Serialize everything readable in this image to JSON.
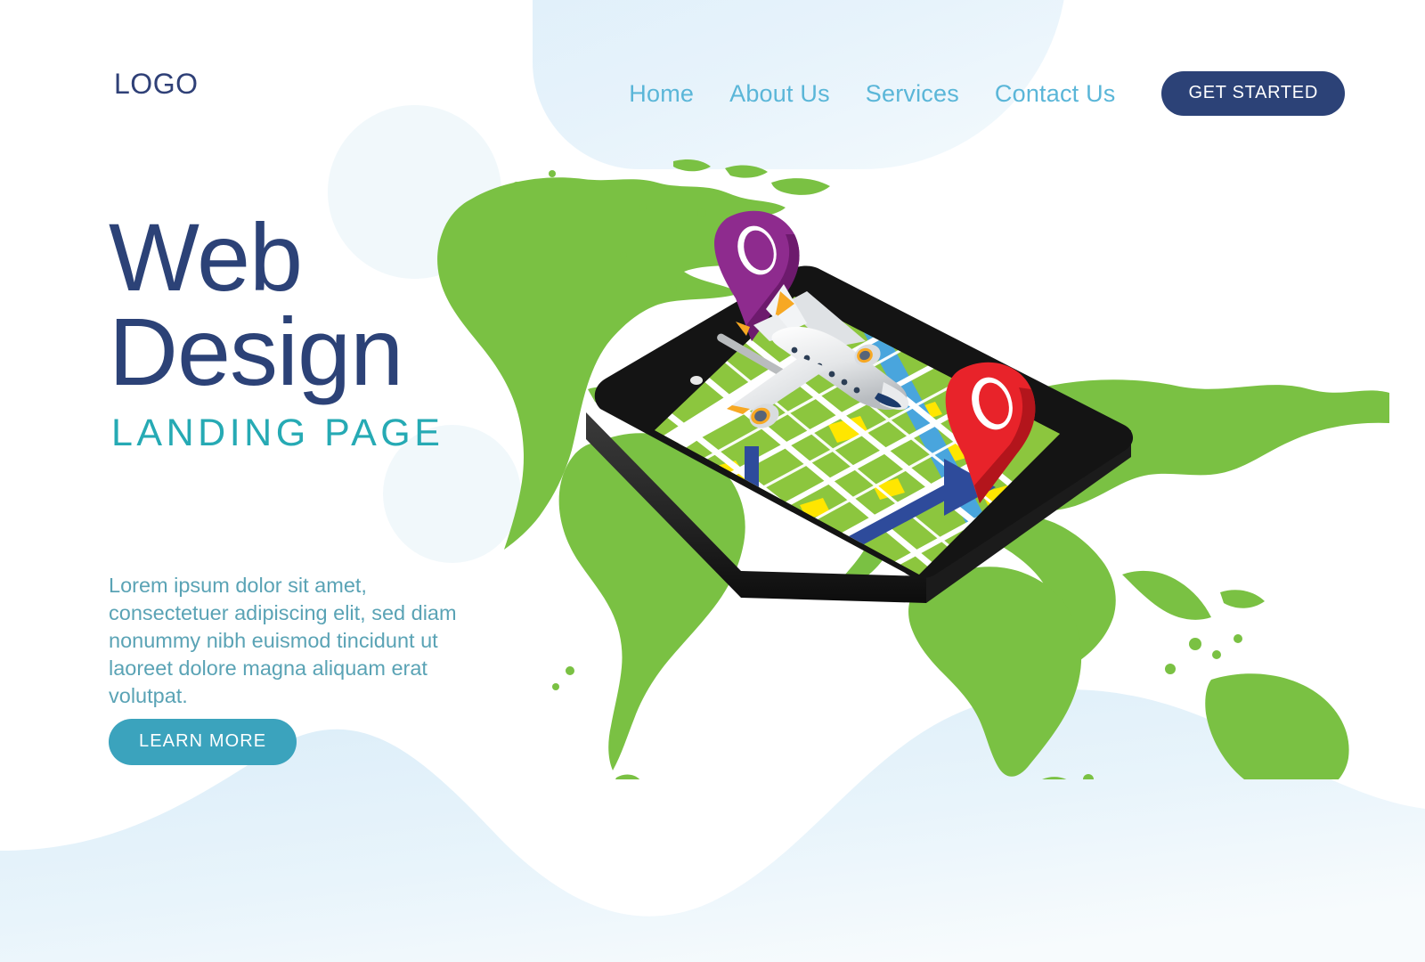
{
  "header": {
    "logo": "LOGO",
    "nav_items": [
      {
        "label": "Home"
      },
      {
        "label": "About Us"
      },
      {
        "label": "Services"
      },
      {
        "label": "Contact Us"
      }
    ],
    "cta_label": "GET STARTED"
  },
  "hero": {
    "title_line1": "Web",
    "title_line2": "Design",
    "subtitle": "LANDING PAGE",
    "body": "Lorem ipsum dolor sit amet, consectetuer adipiscing elit, sed diam nonummy nibh euismod tincidunt ut laoreet dolore magna aliquam erat volutpat.",
    "button_label": "LEARN MORE"
  },
  "illustration": {
    "name": "isometric-smartphone-navigation-map",
    "elements": [
      "world-map",
      "smartphone",
      "street-map-screen",
      "airplane",
      "purple-location-pin",
      "red-location-pin",
      "blue-route-arrow",
      "blue-river"
    ]
  },
  "colors": {
    "navy": "#2c4277",
    "nav_blue": "#5ab6d8",
    "teal": "#26aab4",
    "teal_button": "#3ba3bd",
    "body_text": "#5aa3b5",
    "map_green": "#7ac143",
    "map_screen_green": "#8cc63e",
    "pin_red": "#e8232a",
    "pin_purple": "#8e2b8e",
    "route_blue": "#2e4b9b",
    "river_blue": "#49a5dd",
    "map_yellow": "#ffe600",
    "phone_black": "#141414",
    "pale_blue": "#dceefa",
    "faint_circle": "#f1f8fb",
    "background": "#ffffff"
  }
}
